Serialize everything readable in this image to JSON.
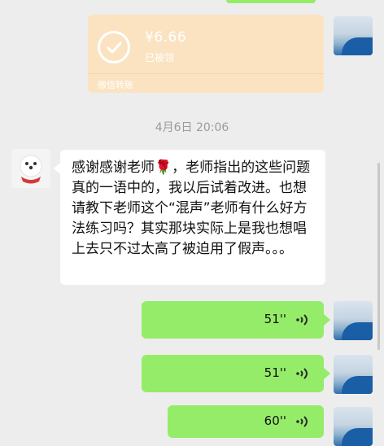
{
  "transfer": {
    "amount": "¥6.66",
    "status": "已被领",
    "footer": "微信转账"
  },
  "timestamp": "4月6日 20:06",
  "message": {
    "text": "感谢感谢老师🌹，老师指出的这些问题真的一语中的，我以后试着改进。也想请教下老师这个“混声”老师有什么好方法练习吗？其实那块实际上是我也想唱上去只不过太高了被迫用了假声。。。"
  },
  "voice_messages": [
    {
      "duration": "51''"
    },
    {
      "duration": "51''"
    },
    {
      "duration": "60''"
    }
  ],
  "colors": {
    "background": "#ededed",
    "bubble_green": "#95ec69",
    "bubble_white": "#ffffff",
    "transfer_orange": "#fbe3c2"
  },
  "icons": [
    "check-circle-icon",
    "voice-wave-icon",
    "avatar-user-icon"
  ]
}
